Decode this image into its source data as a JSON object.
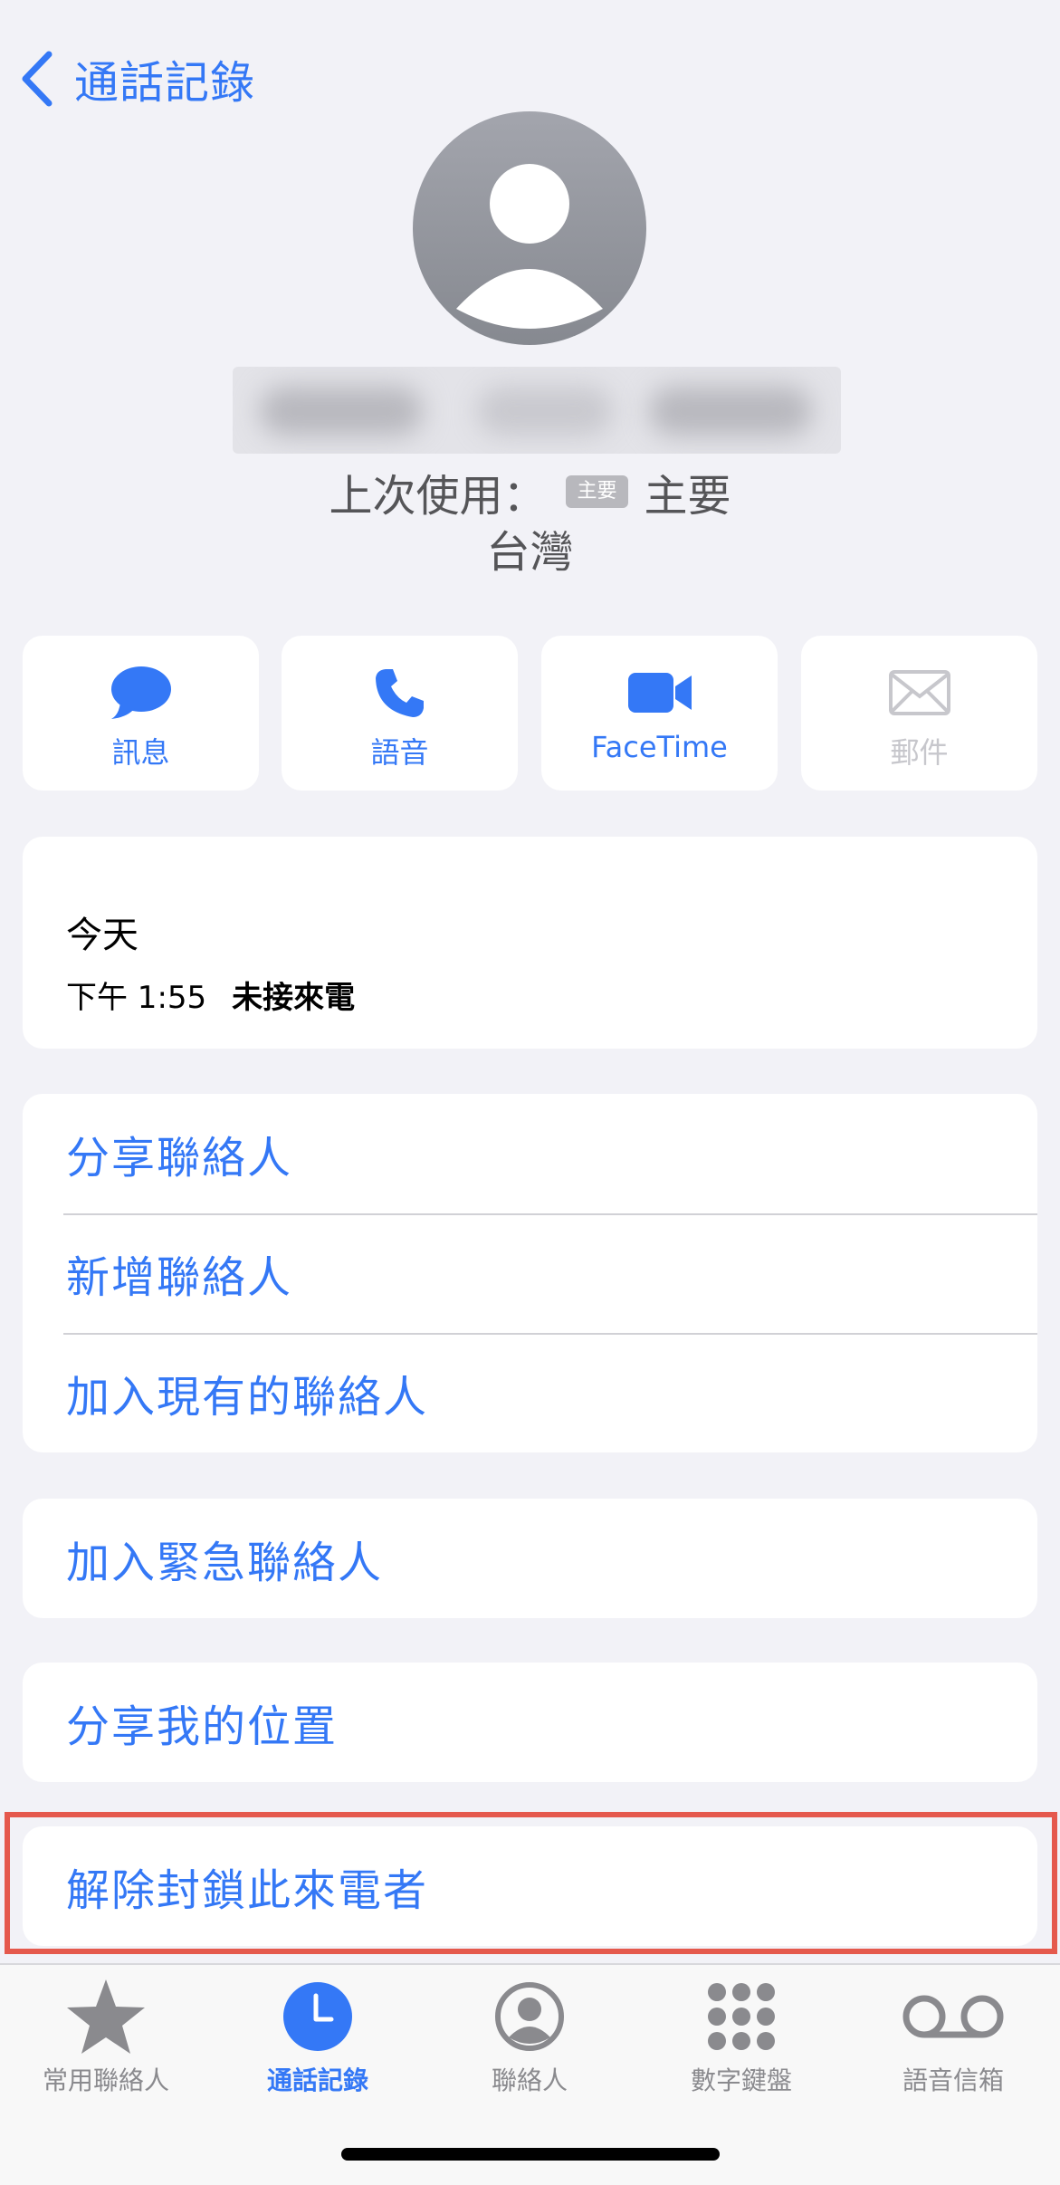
{
  "nav": {
    "back_label": "通話記錄"
  },
  "contact": {
    "last_used_prefix": "上次使用：",
    "badge": "主要",
    "last_used_line": "主要",
    "region": "台灣"
  },
  "actions": [
    {
      "label": "訊息",
      "icon": "message-bubble-icon",
      "enabled": true
    },
    {
      "label": "語音",
      "icon": "phone-icon",
      "enabled": true
    },
    {
      "label": "FaceTime",
      "icon": "video-camera-icon",
      "enabled": true
    },
    {
      "label": "郵件",
      "icon": "envelope-icon",
      "enabled": false
    }
  ],
  "history": {
    "day": "今天",
    "time": "下午 1:55",
    "status": "未接來電"
  },
  "menu": {
    "share_contact": "分享聯絡人",
    "new_contact": "新增聯絡人",
    "add_existing": "加入現有的聯絡人",
    "add_emergency": "加入緊急聯絡人",
    "share_location": "分享我的位置",
    "unblock": "解除封鎖此來電者"
  },
  "tabs": [
    {
      "label": "常用聯絡人",
      "icon": "star-icon",
      "active": false
    },
    {
      "label": "通話記錄",
      "icon": "clock-icon",
      "active": true
    },
    {
      "label": "聯絡人",
      "icon": "person-circle-icon",
      "active": false
    },
    {
      "label": "數字鍵盤",
      "icon": "keypad-icon",
      "active": false
    },
    {
      "label": "語音信箱",
      "icon": "voicemail-icon",
      "active": false
    }
  ],
  "colors": {
    "accent": "#3478f6",
    "highlight": "#e5594d",
    "background": "#f2f2f7"
  }
}
